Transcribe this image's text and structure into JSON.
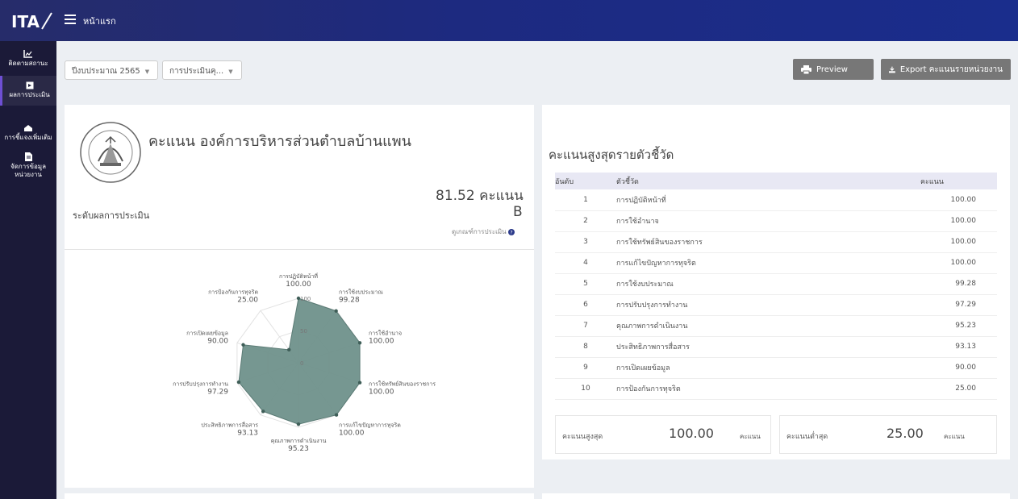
{
  "header": {
    "title": "หน้าแรก",
    "logo_text": "ITA"
  },
  "sidebar": {
    "items": [
      {
        "label": "ติดตามสถานะ"
      },
      {
        "label": "ผลการประเมิน"
      },
      {
        "label": "การชี้แจงเพิ่มเติม"
      },
      {
        "label": "จัดการข้อมูล หน่วยงาน"
      }
    ]
  },
  "filters": {
    "year": "ปีงบประมาณ 2565",
    "assessment": "การประเมินคุ..."
  },
  "toolbar": {
    "preview_label": "Preview",
    "export_label": "Export คะแนนรายหน่วยงาน"
  },
  "summary": {
    "org_title": "คะแนน องค์การบริหารส่วนตำบลบ้านแพน",
    "score_text": "81.52 คะแนน",
    "level_label": "ระดับผลการประเมิน",
    "grade": "B",
    "criteria_link": "ดูเกณฑ์การประเมิน"
  },
  "radar": {
    "max": 100,
    "ticks": [
      "0",
      "50",
      "100"
    ],
    "fill_color": "#6f918b",
    "axes": [
      {
        "label": "การปฏิบัติหน้าที่",
        "value": "100.00"
      },
      {
        "label": "การใช้งบประมาณ",
        "value": "99.28"
      },
      {
        "label": "การใช้อำนาจ",
        "value": "100.00"
      },
      {
        "label": "การใช้ทรัพย์สินของราชการ",
        "value": "100.00"
      },
      {
        "label": "การแก้ไขปัญหาการทุจริต",
        "value": "100.00"
      },
      {
        "label": "คุณภาพการดำเนินงาน",
        "value": "95.23"
      },
      {
        "label": "ประสิทธิภาพการสื่อสาร",
        "value": "93.13"
      },
      {
        "label": "การปรับปรุงการทำงาน",
        "value": "97.29"
      },
      {
        "label": "การเปิดเผยข้อมูล",
        "value": "90.00"
      },
      {
        "label": "การป้องกันการทุจริต",
        "value": "25.00"
      }
    ]
  },
  "ranking": {
    "title": "คะแนนสูงสุดรายตัวชี้วัด",
    "columns": [
      "อันดับ",
      "ตัวชี้วัด",
      "คะแนน"
    ],
    "rows": [
      {
        "rank": "1",
        "indicator": "การปฏิบัติหน้าที่",
        "score": "100.00"
      },
      {
        "rank": "2",
        "indicator": "การใช้อำนาจ",
        "score": "100.00"
      },
      {
        "rank": "3",
        "indicator": "การใช้ทรัพย์สินของราชการ",
        "score": "100.00"
      },
      {
        "rank": "4",
        "indicator": "การแก้ไขปัญหาการทุจริต",
        "score": "100.00"
      },
      {
        "rank": "5",
        "indicator": "การใช้งบประมาณ",
        "score": "99.28"
      },
      {
        "rank": "6",
        "indicator": "การปรับปรุงการทำงาน",
        "score": "97.29"
      },
      {
        "rank": "7",
        "indicator": "คุณภาพการดำเนินงาน",
        "score": "95.23"
      },
      {
        "rank": "8",
        "indicator": "ประสิทธิภาพการสื่อสาร",
        "score": "93.13"
      },
      {
        "rank": "9",
        "indicator": "การเปิดเผยข้อมูล",
        "score": "90.00"
      },
      {
        "rank": "10",
        "indicator": "การป้องกันการทุจริต",
        "score": "25.00"
      }
    ]
  },
  "stats": {
    "max_label": "คะแนนสูงสุด",
    "max_value": "100.00",
    "max_unit": "คะแนน",
    "min_label": "คะแนนต่ำสุด",
    "min_value": "25.00",
    "min_unit": "คะแนน"
  },
  "colors": {
    "topbar": "#1d2a80",
    "sidebar": "#1b1a38",
    "button": "#777777",
    "accent": "#6e4fd3",
    "radar_fill": "#6f918b"
  }
}
